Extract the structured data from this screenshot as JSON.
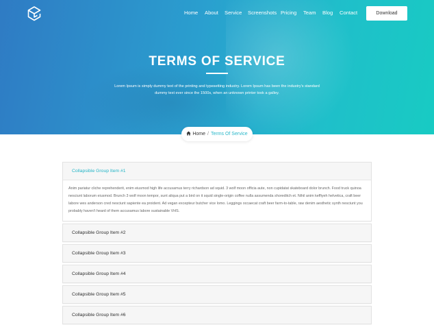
{
  "nav": {
    "items": [
      "Home",
      "About",
      "Service",
      "Screenshots",
      "Pricing",
      "Team",
      "Blog",
      "Contact"
    ],
    "download_label": "Download"
  },
  "hero": {
    "title": "TERMS OF SERVICE",
    "subtitle": "Lorem Ipsum is simply dummy text of the printing and typesetting industry. Lorem Ipsum has been the industry's standard dummy text ever since the 1500s, when an unknown printer took a galley."
  },
  "breadcrumb": {
    "home": "Home",
    "separator": "/",
    "current": "Terms Of Service"
  },
  "accordion": {
    "items": [
      {
        "title": "Collapsible Group Item #1",
        "expanded": true,
        "body": "Anim pariatur cliche reprehenderit, enim eiusmod high life accusamus terry richardson ad squid. 3 wolf moon officia aute, non cupidatat skateboard dolor brunch. Food truck quinoa nesciunt laborum eiusmod. Brunch 3 wolf moon tempor, sunt aliqua put a bird on it squid single-origin coffee nulla assumenda shoreditch et. Nihil anim keffiyeh helvetica, craft beer labore wes anderson cred nesciunt sapiente ea proident. Ad vegan excepteur butcher vice lomo. Leggings occaecat craft beer farm-to-table, raw denim aesthetic synth nesciunt you probably haven't heard of them accusamus labore sustainable VHS."
      },
      {
        "title": "Collapsible Group Item #2",
        "expanded": false
      },
      {
        "title": "Collapsible Group Item #3",
        "expanded": false
      },
      {
        "title": "Collapsible Group Item #4",
        "expanded": false
      },
      {
        "title": "Collapsible Group Item #5",
        "expanded": false
      },
      {
        "title": "Collapsible Group Item #6",
        "expanded": false
      }
    ]
  },
  "colors": {
    "accent": "#27b7c9",
    "hero_gradient_start": "#2f7bc4",
    "hero_gradient_end": "#18cbc3"
  },
  "icons": {
    "logo": "cube-logo-icon",
    "breadcrumb_home": "home-icon"
  }
}
